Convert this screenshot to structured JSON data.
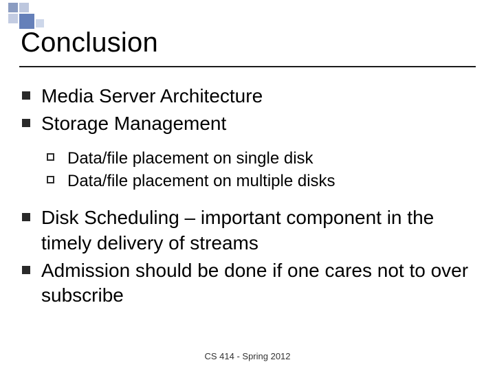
{
  "slide": {
    "title": "Conclusion",
    "footer": "CS 414 - Spring 2012",
    "bullets": {
      "b1": "Media Server Architecture",
      "b2": "Storage Management",
      "b2a": "Data/file placement on single disk",
      "b2b": "Data/file placement on multiple disks",
      "b3": "Disk Scheduling – important component in the timely delivery of streams",
      "b4": "Admission should be done if one cares not to over subscribe"
    }
  }
}
